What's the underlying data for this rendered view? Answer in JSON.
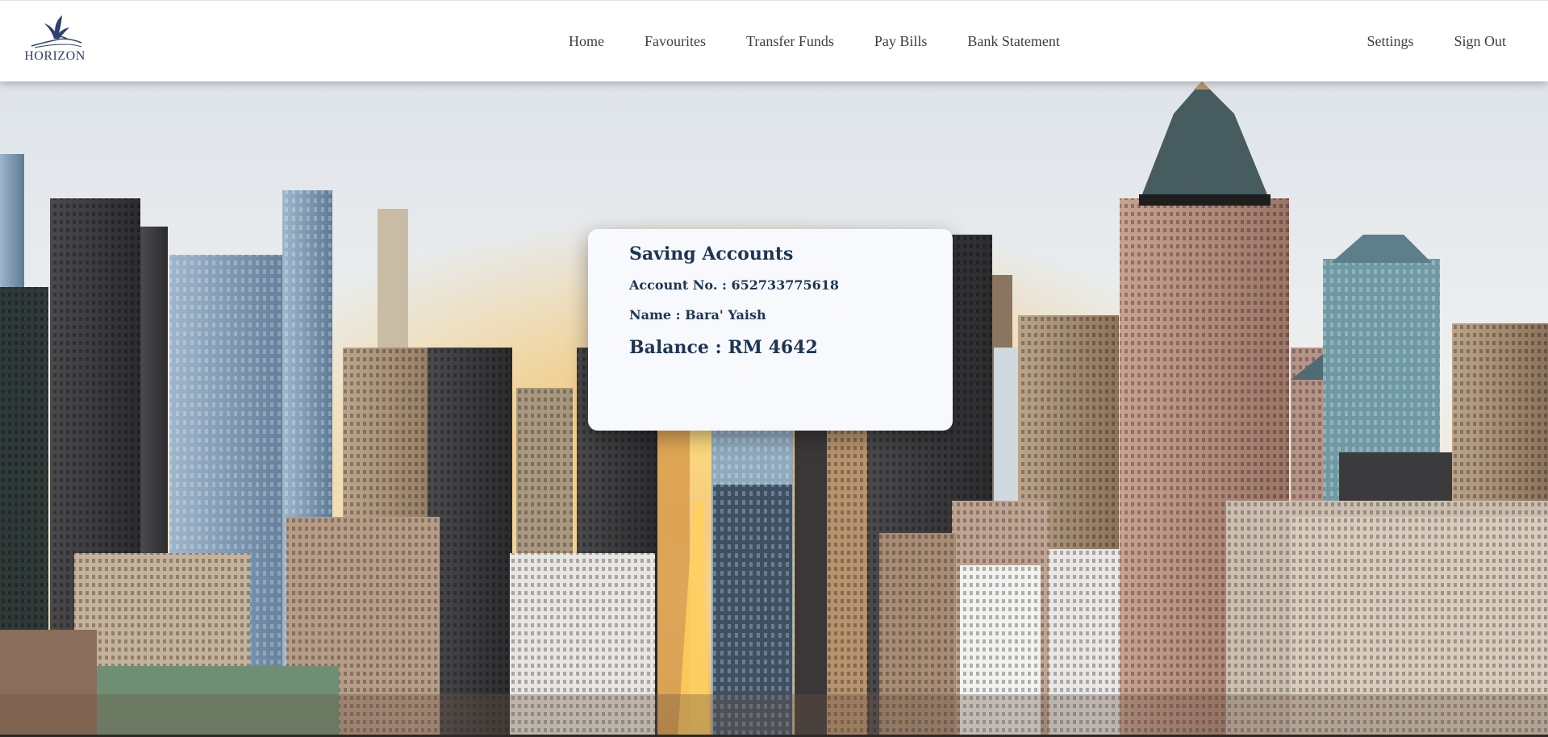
{
  "brand": {
    "name": "HORIZON",
    "logo_icon": "bird-icon",
    "color": "#2f3f6e"
  },
  "nav": {
    "main": [
      {
        "label": "Home"
      },
      {
        "label": "Favourites"
      },
      {
        "label": "Transfer Funds"
      },
      {
        "label": "Pay Bills"
      },
      {
        "label": "Bank Statement"
      }
    ],
    "right": [
      {
        "label": "Settings"
      },
      {
        "label": "Sign Out"
      }
    ]
  },
  "account": {
    "title": "Saving Accounts",
    "number_label": "Account No. :",
    "number": "652733775618",
    "name_label": "Name :",
    "name": "Bara' Yaish",
    "balance_label": "Balance :",
    "balance": "RM 4642"
  },
  "colors": {
    "card_text": "#1c3552",
    "card_bg": "#f8f9fd",
    "nav_text": "#3d3d3d"
  },
  "background": {
    "icon": "city-skyline-photo"
  }
}
